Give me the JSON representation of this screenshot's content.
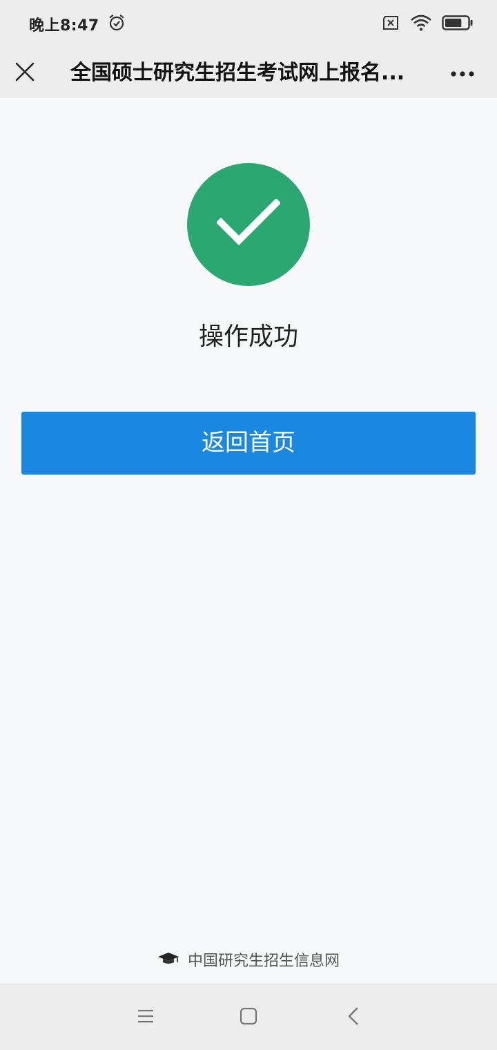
{
  "status_bar": {
    "time": "晚上8:47",
    "icons": [
      "alarm-icon",
      "sim-off-icon",
      "wifi-icon",
      "battery-icon"
    ],
    "battery_level": 0.75
  },
  "nav_bar": {
    "title": "全国硕士研究生招生考试网上报名...",
    "close_icon": "close-icon",
    "more_icon": "more-icon"
  },
  "main": {
    "success_icon": "check-circle-icon",
    "success_color": "#2ba771",
    "success_text": "操作成功",
    "home_button_label": "返回首页",
    "button_color": "#1a87e1"
  },
  "footer": {
    "logo_icon": "graduation-cap-icon",
    "text": "中国研究生招生信息网"
  },
  "system_nav": {
    "buttons": [
      "menu-icon",
      "home-icon",
      "back-icon"
    ]
  }
}
